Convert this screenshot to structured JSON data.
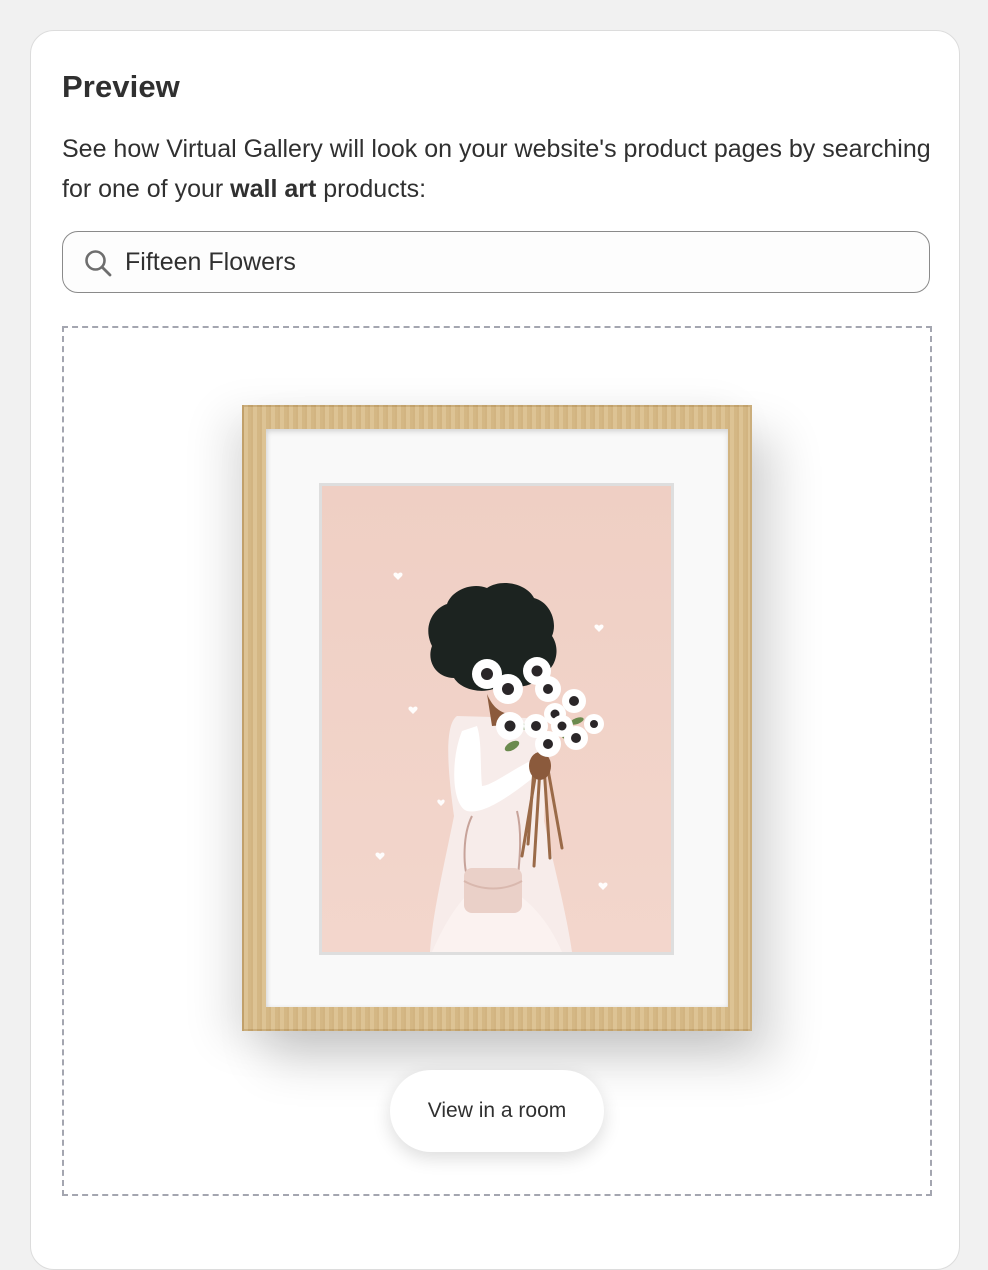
{
  "card": {
    "title": "Preview",
    "description_before": "See how Virtual Gallery will look on your website's product pages by searching for one of your ",
    "description_bold": "wall art",
    "description_after": " products:"
  },
  "search": {
    "icon": "search-icon",
    "value": "Fifteen Flowers"
  },
  "preview": {
    "artwork_icon": "framed-artwork-image",
    "view_in_room_label": "View in a room"
  },
  "colors": {
    "frame_wood": "#d8bd8c",
    "artwork_background": "#f2d4c9",
    "dashed_border": "#a4a6b0"
  }
}
